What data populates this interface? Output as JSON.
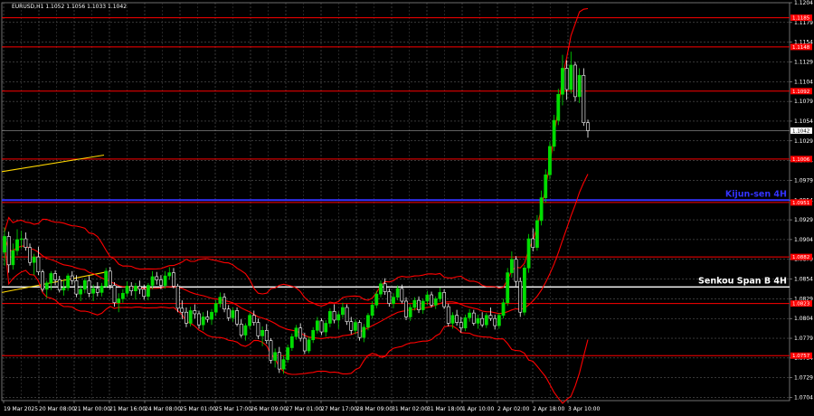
{
  "chart_data": {
    "type": "candlestick",
    "title": "EURUSD,H1  1.1052 1.1056 1.1033 1.1042",
    "current_price": 1.1042,
    "ylim": [
      1.07,
      1.1204
    ],
    "y_ticks": [
      "1.1204",
      "1.1179",
      "1.1154",
      "1.1129",
      "1.1104",
      "1.1079",
      "1.1054",
      "1.1029",
      "1.1004",
      "1.0979",
      "1.0954",
      "1.0929",
      "1.0904",
      "1.0879",
      "1.0854",
      "1.0829",
      "1.0804",
      "1.0779",
      "1.0754",
      "1.0729",
      "1.0704"
    ],
    "x_ticks": [
      "19 Mar 2025",
      "20 Mar 08:00",
      "21 Mar 00:00",
      "21 Mar 16:00",
      "24 Mar 08:00",
      "25 Mar 01:00",
      "25 Mar 17:00",
      "26 Mar 09:00",
      "27 Mar 01:00",
      "27 Mar 17:00",
      "28 Mar 09:00",
      "31 Mar 02:00",
      "31 Mar 18:00",
      "1 Apr 10:00",
      "2 Apr 02:00",
      "2 Apr 18:00",
      "3 Apr 10:00"
    ],
    "levels": [
      {
        "price": 1.1185,
        "label": "1.1185",
        "color": "#ff0000"
      },
      {
        "price": 1.1148,
        "label": "1.1148",
        "color": "#ff0000"
      },
      {
        "price": 1.1092,
        "label": "1.1092",
        "color": "#ff0000"
      },
      {
        "price": 1.1006,
        "label": "1.1006",
        "color": "#ff0000"
      },
      {
        "price": 1.0951,
        "label": "1.0951",
        "color": "#ff0000"
      },
      {
        "price": 1.0882,
        "label": "1.0882",
        "color": "#ff0000"
      },
      {
        "price": 1.0823,
        "label": "1.0823",
        "color": "#ff0000"
      },
      {
        "price": 1.0757,
        "label": "1.0757",
        "color": "#ff0000"
      }
    ],
    "kijun": {
      "label": "Kijun-sen 4H",
      "price": 1.0954,
      "color": "#3333ff"
    },
    "senkou": {
      "label": "Senkou Span B 4H",
      "price": 1.0844,
      "color": "#ffffff"
    },
    "colors": {
      "background": "#000000",
      "bull": "#00dd00",
      "bear": "#ffffff",
      "bands": "#ff0000",
      "trend": "#ffd700"
    },
    "candles": [
      [
        1.0888,
        1.0919,
        1.0871,
        1.0908
      ],
      [
        1.0908,
        1.0914,
        1.0862,
        1.0872
      ],
      [
        1.0872,
        1.0899,
        1.0866,
        1.089
      ],
      [
        1.089,
        1.0917,
        1.0884,
        1.0904
      ],
      [
        1.0904,
        1.0915,
        1.0893,
        1.0905
      ],
      [
        1.0905,
        1.0913,
        1.089,
        1.0894
      ],
      [
        1.0894,
        1.0899,
        1.0871,
        1.0875
      ],
      [
        1.0875,
        1.0886,
        1.0859,
        1.0882
      ],
      [
        1.0882,
        1.0895,
        1.0859,
        1.0863
      ],
      [
        1.0863,
        1.0866,
        1.0838,
        1.0841
      ],
      [
        1.0841,
        1.0852,
        1.083,
        1.0849
      ],
      [
        1.0849,
        1.0864,
        1.084,
        1.0861
      ],
      [
        1.0861,
        1.0865,
        1.0846,
        1.0853
      ],
      [
        1.0853,
        1.0858,
        1.0837,
        1.084
      ],
      [
        1.084,
        1.0852,
        1.0833,
        1.0843
      ],
      [
        1.0843,
        1.0861,
        1.0839,
        1.0858
      ],
      [
        1.0858,
        1.0864,
        1.0847,
        1.0852
      ],
      [
        1.0852,
        1.0859,
        1.0831,
        1.0835
      ],
      [
        1.0835,
        1.0846,
        1.0826,
        1.0841
      ],
      [
        1.0841,
        1.0855,
        1.0836,
        1.0852
      ],
      [
        1.0852,
        1.0858,
        1.0831,
        1.0836
      ],
      [
        1.0836,
        1.0847,
        1.0826,
        1.0842
      ],
      [
        1.0842,
        1.085,
        1.0832,
        1.0837
      ],
      [
        1.0837,
        1.0849,
        1.0832,
        1.0845
      ],
      [
        1.0845,
        1.0868,
        1.0843,
        1.0864
      ],
      [
        1.0864,
        1.0869,
        1.0841,
        1.0846
      ],
      [
        1.0846,
        1.085,
        1.0819,
        1.0824
      ],
      [
        1.0824,
        1.0836,
        1.0812,
        1.0829
      ],
      [
        1.0829,
        1.0841,
        1.0824,
        1.0836
      ],
      [
        1.0836,
        1.0851,
        1.0832,
        1.0845
      ],
      [
        1.0845,
        1.085,
        1.0833,
        1.0839
      ],
      [
        1.0839,
        1.0849,
        1.0828,
        1.0845
      ],
      [
        1.0845,
        1.0852,
        1.0835,
        1.0841
      ],
      [
        1.0841,
        1.0847,
        1.0828,
        1.0832
      ],
      [
        1.0832,
        1.0849,
        1.0827,
        1.0846
      ],
      [
        1.0846,
        1.0864,
        1.0841,
        1.0857
      ],
      [
        1.0857,
        1.0863,
        1.0847,
        1.0853
      ],
      [
        1.0853,
        1.0859,
        1.0841,
        1.0846
      ],
      [
        1.0846,
        1.0864,
        1.0842,
        1.0858
      ],
      [
        1.0858,
        1.0869,
        1.0853,
        1.0862
      ],
      [
        1.0862,
        1.0868,
        1.0842,
        1.0845
      ],
      [
        1.0845,
        1.0848,
        1.0812,
        1.0817
      ],
      [
        1.0817,
        1.0827,
        1.0803,
        1.0812
      ],
      [
        1.0812,
        1.0818,
        1.0793,
        1.0798
      ],
      [
        1.0798,
        1.0819,
        1.0794,
        1.0814
      ],
      [
        1.0814,
        1.0822,
        1.0804,
        1.081
      ],
      [
        1.081,
        1.0814,
        1.0791,
        1.0796
      ],
      [
        1.0796,
        1.0812,
        1.0789,
        1.0806
      ],
      [
        1.0806,
        1.0814,
        1.0799,
        1.0803
      ],
      [
        1.0803,
        1.0816,
        1.0796,
        1.0812
      ],
      [
        1.0812,
        1.0827,
        1.0807,
        1.0823
      ],
      [
        1.0823,
        1.0837,
        1.0818,
        1.0831
      ],
      [
        1.0831,
        1.0836,
        1.0812,
        1.0816
      ],
      [
        1.0816,
        1.0821,
        1.0801,
        1.0805
      ],
      [
        1.0805,
        1.0818,
        1.08,
        1.0814
      ],
      [
        1.0814,
        1.0818,
        1.0794,
        1.0797
      ],
      [
        1.0797,
        1.0803,
        1.078,
        1.0783
      ],
      [
        1.0783,
        1.0798,
        1.0776,
        1.0795
      ],
      [
        1.0795,
        1.0811,
        1.0791,
        1.0808
      ],
      [
        1.0808,
        1.0814,
        1.0795,
        1.0799
      ],
      [
        1.0799,
        1.0804,
        1.0778,
        1.0782
      ],
      [
        1.0782,
        1.0794,
        1.0769,
        1.0789
      ],
      [
        1.0789,
        1.0797,
        1.0772,
        1.0776
      ],
      [
        1.0776,
        1.0779,
        1.0747,
        1.0751
      ],
      [
        1.0751,
        1.0766,
        1.0742,
        1.0761
      ],
      [
        1.0761,
        1.0768,
        1.0735,
        1.074
      ],
      [
        1.074,
        1.0757,
        1.0734,
        1.0752
      ],
      [
        1.0752,
        1.0771,
        1.0748,
        1.0767
      ],
      [
        1.0767,
        1.0785,
        1.0763,
        1.0781
      ],
      [
        1.0781,
        1.0796,
        1.0777,
        1.0792
      ],
      [
        1.0792,
        1.0798,
        1.0775,
        1.0779
      ],
      [
        1.0779,
        1.0786,
        1.0759,
        1.0763
      ],
      [
        1.0763,
        1.0781,
        1.076,
        1.0777
      ],
      [
        1.0777,
        1.0793,
        1.0773,
        1.0789
      ],
      [
        1.0789,
        1.0806,
        1.0785,
        1.0801
      ],
      [
        1.0801,
        1.0804,
        1.0783,
        1.0787
      ],
      [
        1.0787,
        1.0802,
        1.0781,
        1.0798
      ],
      [
        1.0798,
        1.0817,
        1.0793,
        1.0813
      ],
      [
        1.0813,
        1.0822,
        1.0798,
        1.0802
      ],
      [
        1.0802,
        1.0813,
        1.0791,
        1.0809
      ],
      [
        1.0809,
        1.0824,
        1.0805,
        1.0818
      ],
      [
        1.0818,
        1.0822,
        1.0796,
        1.08
      ],
      [
        1.08,
        1.0806,
        1.0784,
        1.0789
      ],
      [
        1.0789,
        1.0803,
        1.0784,
        1.0799
      ],
      [
        1.0799,
        1.0802,
        1.0776,
        1.078
      ],
      [
        1.078,
        1.0797,
        1.0774,
        1.0793
      ],
      [
        1.0793,
        1.0811,
        1.0789,
        1.0808
      ],
      [
        1.0808,
        1.0826,
        1.0804,
        1.0821
      ],
      [
        1.0821,
        1.0839,
        1.0817,
        1.0835
      ],
      [
        1.0835,
        1.0852,
        1.0831,
        1.0848
      ],
      [
        1.0848,
        1.0855,
        1.0834,
        1.0838
      ],
      [
        1.0838,
        1.0842,
        1.0819,
        1.0823
      ],
      [
        1.0823,
        1.0836,
        1.0817,
        1.0831
      ],
      [
        1.0831,
        1.0846,
        1.0827,
        1.0842
      ],
      [
        1.0842,
        1.0847,
        1.0823,
        1.0826
      ],
      [
        1.0826,
        1.0831,
        1.0802,
        1.0806
      ],
      [
        1.0806,
        1.0822,
        1.0801,
        1.0818
      ],
      [
        1.0818,
        1.0831,
        1.0814,
        1.0827
      ],
      [
        1.0827,
        1.0832,
        1.0811,
        1.0815
      ],
      [
        1.0815,
        1.0829,
        1.081,
        1.0826
      ],
      [
        1.0826,
        1.0839,
        1.0821,
        1.0834
      ],
      [
        1.0834,
        1.0838,
        1.0818,
        1.0821
      ],
      [
        1.0821,
        1.0832,
        1.0816,
        1.0829
      ],
      [
        1.0829,
        1.0843,
        1.0825,
        1.0837
      ],
      [
        1.0837,
        1.0841,
        1.0816,
        1.0819
      ],
      [
        1.0819,
        1.0823,
        1.0794,
        1.0798
      ],
      [
        1.0798,
        1.0812,
        1.0791,
        1.0808
      ],
      [
        1.0808,
        1.0815,
        1.0795,
        1.0799
      ],
      [
        1.0799,
        1.0806,
        1.0786,
        1.0792
      ],
      [
        1.0792,
        1.0809,
        1.0788,
        1.0805
      ],
      [
        1.0805,
        1.0816,
        1.08,
        1.0811
      ],
      [
        1.0811,
        1.0815,
        1.0795,
        1.0798
      ],
      [
        1.0798,
        1.0809,
        1.0791,
        1.0804
      ],
      [
        1.0804,
        1.0812,
        1.0793,
        1.0796
      ],
      [
        1.0796,
        1.0811,
        1.0792,
        1.0808
      ],
      [
        1.0808,
        1.0818,
        1.0801,
        1.0804
      ],
      [
        1.0804,
        1.0809,
        1.079,
        1.0795
      ],
      [
        1.0795,
        1.0811,
        1.0791,
        1.0808
      ],
      [
        1.0808,
        1.0829,
        1.0804,
        1.0824
      ],
      [
        1.0824,
        1.0868,
        1.082,
        1.0862
      ],
      [
        1.0862,
        1.0889,
        1.0856,
        1.0879
      ],
      [
        1.0879,
        1.0883,
        1.0845,
        1.0851
      ],
      [
        1.0851,
        1.0856,
        1.0806,
        1.0812
      ],
      [
        1.0812,
        1.0872,
        1.0808,
        1.0868
      ],
      [
        1.0868,
        1.0911,
        1.0862,
        1.0905
      ],
      [
        1.0905,
        1.0918,
        1.0889,
        1.0894
      ],
      [
        1.0894,
        1.0935,
        1.089,
        1.0928
      ],
      [
        1.0928,
        1.0966,
        1.0922,
        1.0957
      ],
      [
        1.0957,
        1.0993,
        1.0951,
        1.0986
      ],
      [
        1.0986,
        1.1028,
        1.098,
        1.1022
      ],
      [
        1.1022,
        1.1062,
        1.1016,
        1.1055
      ],
      [
        1.1055,
        1.1095,
        1.1049,
        1.1088
      ],
      [
        1.1088,
        1.1138,
        1.1074,
        1.1121
      ],
      [
        1.1121,
        1.1131,
        1.1081,
        1.1094
      ],
      [
        1.1094,
        1.1142,
        1.1089,
        1.1125
      ],
      [
        1.1125,
        1.1129,
        1.1079,
        1.1085
      ],
      [
        1.1085,
        1.1121,
        1.1077,
        1.1112
      ],
      [
        1.1112,
        1.1121,
        1.1048,
        1.1052
      ],
      [
        1.1052,
        1.1056,
        1.1033,
        1.1042
      ]
    ]
  }
}
